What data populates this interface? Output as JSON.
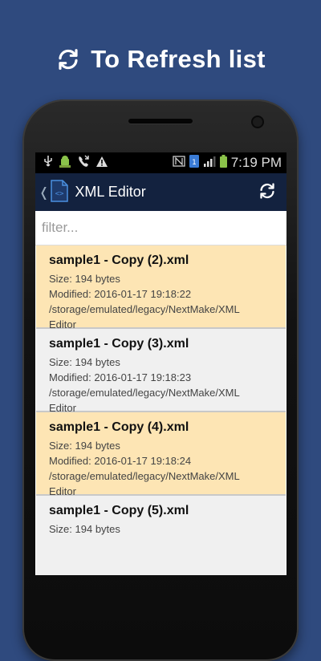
{
  "promo": {
    "title": "To Refresh list",
    "icon": "refresh-icon"
  },
  "status_bar": {
    "time": "7:19 PM"
  },
  "app_bar": {
    "title": "XML Editor",
    "refresh_icon": "refresh-icon"
  },
  "filter": {
    "placeholder": "filter..."
  },
  "files": [
    {
      "name": "sample1 - Copy (2).xml",
      "size": "Size: 194 bytes",
      "modified": "Modified: 2016-01-17 19:18:22",
      "path_line1": "/storage/emulated/legacy/NextMake/XML",
      "path_line2": "Editor",
      "highlighted": true
    },
    {
      "name": "sample1 - Copy (3).xml",
      "size": "Size: 194 bytes",
      "modified": "Modified: 2016-01-17 19:18:23",
      "path_line1": "/storage/emulated/legacy/NextMake/XML",
      "path_line2": "Editor",
      "highlighted": false
    },
    {
      "name": "sample1 - Copy (4).xml",
      "size": "Size: 194 bytes",
      "modified": "Modified: 2016-01-17 19:18:24",
      "path_line1": "/storage/emulated/legacy/NextMake/XML",
      "path_line2": "Editor",
      "highlighted": true
    },
    {
      "name": "sample1 - Copy (5).xml",
      "size": "Size: 194 bytes",
      "highlighted": false
    }
  ],
  "colors": {
    "background": "#2f4a7e",
    "app_bar": "#13223f",
    "highlight_row": "#fde5b4",
    "normal_row": "#f0f0f0"
  }
}
